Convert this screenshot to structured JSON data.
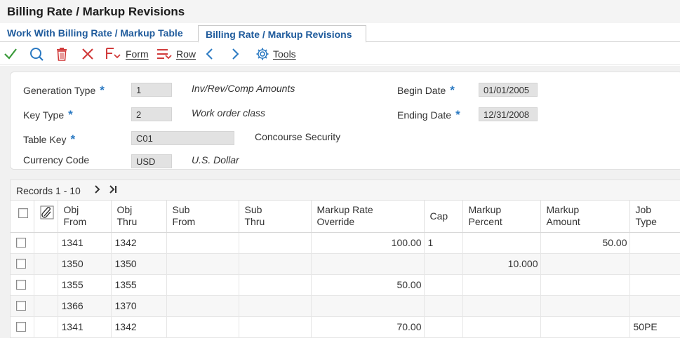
{
  "window": {
    "title": "Billing Rate / Markup Revisions"
  },
  "tabs": [
    {
      "label": "Work With Billing Rate / Markup Table"
    },
    {
      "label": "Billing Rate / Markup Revisions"
    }
  ],
  "toolbar": {
    "form_label": "Form",
    "row_label": "Row",
    "tools_label": "Tools",
    "icons": [
      "check-icon",
      "search-icon",
      "trash-icon",
      "close-icon",
      "form-icon",
      "row-icon",
      "chevron-left-icon",
      "chevron-right-icon",
      "gear-icon"
    ]
  },
  "form": {
    "generation_type": {
      "label": "Generation Type",
      "value": "1",
      "desc": "Inv/Rev/Comp Amounts"
    },
    "key_type": {
      "label": "Key Type",
      "value": "2",
      "desc": "Work order class"
    },
    "table_key": {
      "label": "Table Key",
      "value": "C01",
      "desc": "Concourse Security"
    },
    "currency_code": {
      "label": "Currency Code",
      "value": "USD",
      "desc": "U.S. Dollar"
    },
    "begin_date": {
      "label": "Begin Date",
      "value": "01/01/2005"
    },
    "ending_date": {
      "label": "Ending Date",
      "value": "12/31/2008"
    },
    "required_marker": "*"
  },
  "grid": {
    "records_label": "Records 1 - 10",
    "headers": {
      "obj_from": [
        "Obj",
        "From"
      ],
      "obj_thru": [
        "Obj",
        "Thru"
      ],
      "sub_from": [
        "Sub",
        "From"
      ],
      "sub_thru": [
        "Sub",
        "Thru"
      ],
      "markup_rate": [
        "Markup Rate",
        "Override"
      ],
      "cap": [
        "Cap",
        ""
      ],
      "markup_percent": [
        "Markup",
        "Percent"
      ],
      "markup_amount": [
        "Markup",
        "Amount"
      ],
      "job_type": [
        "Job",
        "Type"
      ]
    },
    "rows": [
      {
        "obj_from": "1341",
        "obj_thru": "1342",
        "sub_from": "",
        "sub_thru": "",
        "markup_rate": "100.00",
        "cap": "1",
        "markup_percent": "",
        "markup_amount": "50.00",
        "job_type": ""
      },
      {
        "obj_from": "1350",
        "obj_thru": "1350",
        "sub_from": "",
        "sub_thru": "",
        "markup_rate": "",
        "cap": "",
        "markup_percent": "10.000",
        "markup_amount": "",
        "job_type": ""
      },
      {
        "obj_from": "1355",
        "obj_thru": "1355",
        "sub_from": "",
        "sub_thru": "",
        "markup_rate": "50.00",
        "cap": "",
        "markup_percent": "",
        "markup_amount": "",
        "job_type": ""
      },
      {
        "obj_from": "1366",
        "obj_thru": "1370",
        "sub_from": "",
        "sub_thru": "",
        "markup_rate": "",
        "cap": "",
        "markup_percent": "",
        "markup_amount": "",
        "job_type": ""
      },
      {
        "obj_from": "1341",
        "obj_thru": "1342",
        "sub_from": "",
        "sub_thru": "",
        "markup_rate": "70.00",
        "cap": "",
        "markup_percent": "",
        "markup_amount": "",
        "job_type": "50PE"
      }
    ]
  }
}
